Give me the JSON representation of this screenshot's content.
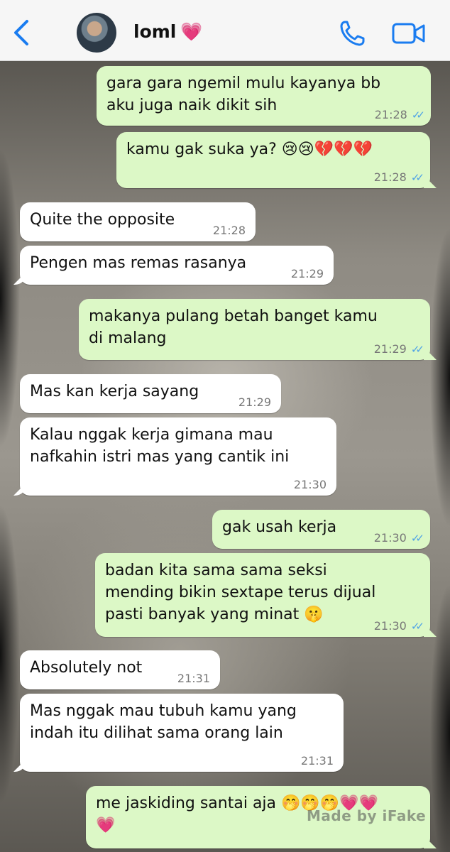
{
  "header": {
    "contact_name": "loml",
    "heart": "💗"
  },
  "messages": [
    {
      "dir": "out",
      "text": "gara gara ngemil mulu kayanya bb\naku juga naik dikit sih",
      "time": "21:28",
      "ticks": "✓✓"
    },
    {
      "dir": "out",
      "text": "kamu gak suka ya? 😢😢💔💔💔",
      "time": "21:28",
      "ticks": "✓✓"
    },
    {
      "dir": "in",
      "text": "Quite the opposite",
      "time": "21:28"
    },
    {
      "dir": "in",
      "text": "Pengen mas remas rasanya",
      "time": "21:29"
    },
    {
      "dir": "out",
      "text": "makanya pulang betah banget kamu\ndi malang",
      "time": "21:29",
      "ticks": "✓✓"
    },
    {
      "dir": "in",
      "text": "Mas kan kerja sayang",
      "time": "21:29"
    },
    {
      "dir": "in",
      "text": "Kalau nggak kerja gimana mau\nnafkahin istri mas yang cantik ini",
      "time": "21:30"
    },
    {
      "dir": "out",
      "text": "gak usah kerja",
      "time": "21:30",
      "ticks": "✓✓"
    },
    {
      "dir": "out",
      "text": "badan kita sama sama seksi\nmending bikin sextape terus dijual\npasti banyak yang minat 🤫",
      "time": "21:30",
      "ticks": "✓✓"
    },
    {
      "dir": "in",
      "text": "Absolutely not",
      "time": "21:31"
    },
    {
      "dir": "in",
      "text": "Mas nggak mau tubuh kamu yang\nindah itu dilihat sama orang lain",
      "time": "21:31"
    },
    {
      "dir": "out",
      "text": "me jaskiding santai aja 🤭🤭🤭💗💗\n💗",
      "time": "",
      "ticks": ""
    }
  ],
  "watermark": "Made by iFake",
  "colors": {
    "outgoing": "#dcf8c6",
    "incoming": "#ffffff",
    "accent": "#1a7cf0",
    "read_ticks": "#4fa3e6"
  },
  "icons": [
    "back-chevron-icon",
    "avatar",
    "phone-icon",
    "video-call-icon"
  ]
}
